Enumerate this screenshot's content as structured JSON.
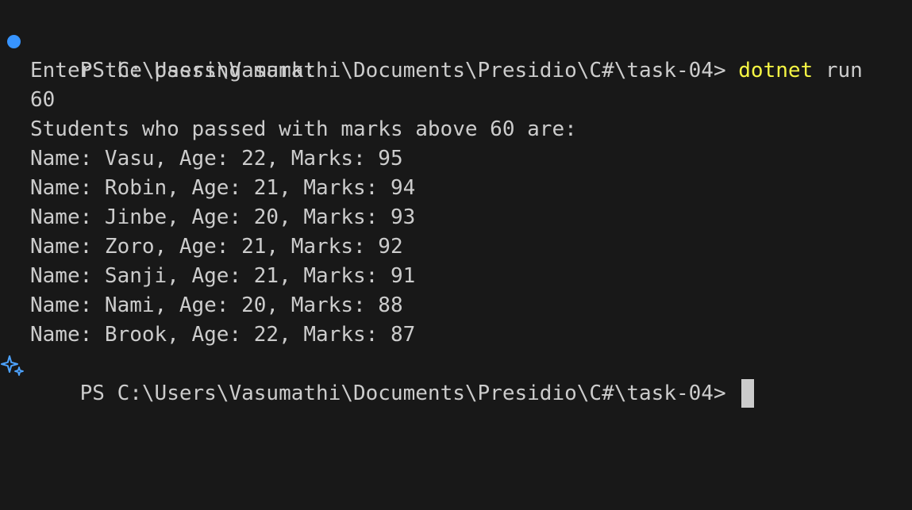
{
  "colors": {
    "background": "#181818",
    "text": "#cccccc",
    "command": "#f5f543",
    "status_dot": "#3794ff",
    "sparkle": "#4da3ff",
    "cursor": "#cccccc"
  },
  "terminal": {
    "prompt1": {
      "decoration_icon": "status-dot-icon",
      "prompt": "PS C:\\Users\\Vasumathi\\Documents\\Presidio\\C#\\task-04> ",
      "command": "dotnet",
      "args": " run"
    },
    "output": [
      "Enter the passing mark:",
      "60",
      "Students who passed with marks above 60 are:",
      "Name: Vasu, Age: 22, Marks: 95",
      "Name: Robin, Age: 21, Marks: 94",
      "Name: Jinbe, Age: 20, Marks: 93",
      "Name: Zoro, Age: 21, Marks: 92",
      "Name: Sanji, Age: 21, Marks: 91",
      "Name: Nami, Age: 20, Marks: 88",
      "Name: Brook, Age: 22, Marks: 87"
    ],
    "prompt2": {
      "decoration_icon": "sparkle-icon",
      "prompt": "PS C:\\Users\\Vasumathi\\Documents\\Presidio\\C#\\task-04> "
    }
  }
}
